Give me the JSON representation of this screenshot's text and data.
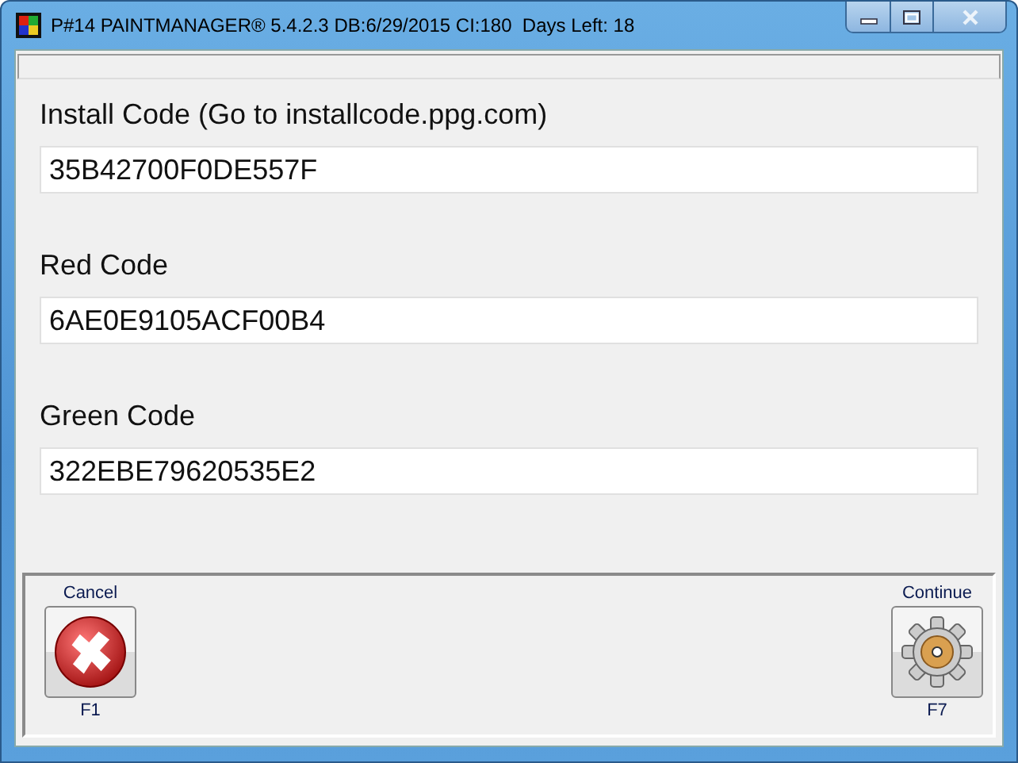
{
  "window": {
    "title": "P#14 PAINTMANAGER® 5.4.2.3 DB:6/29/2015 CI:180  Days Left: 18"
  },
  "fields": [
    {
      "label": "Install Code (Go to installcode.ppg.com)",
      "value": "35B42700F0DE557F"
    },
    {
      "label": "Red Code",
      "value": "6AE0E9105ACF00B4"
    },
    {
      "label": "Green Code",
      "value": "322EBE79620535E2"
    }
  ],
  "buttons": [
    {
      "kind": "cancel",
      "label": "Cancel",
      "key": "F1"
    },
    {
      "kind": "continue",
      "label": "Continue",
      "key": "F7"
    }
  ]
}
